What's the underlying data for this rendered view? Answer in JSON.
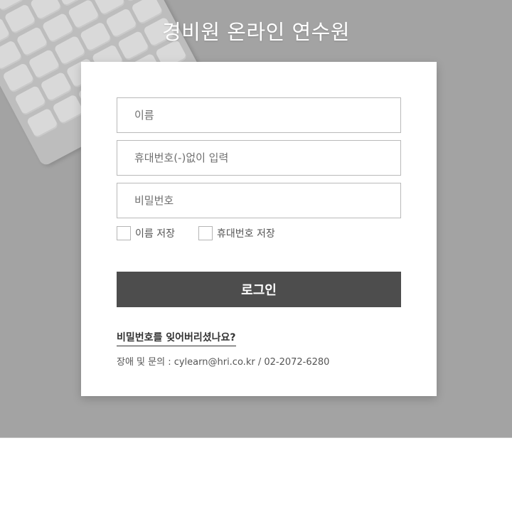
{
  "header": {
    "title": "경비원 온라인 연수원"
  },
  "form": {
    "name_placeholder": "이름",
    "phone_placeholder": "휴대번호(-)없이 입력",
    "password_placeholder": "비밀번호",
    "save_name_label": "이름 저장",
    "save_phone_label": "휴대번호 저장",
    "login_label": "로그인",
    "forgot_password_label": "비밀번호를 잊어버리셨나요?",
    "contact_text": "장애 및 문의 : cylearn@hri.co.kr / 02-2072-6280"
  },
  "colors": {
    "background_band": "#a3a3a3",
    "card": "#ffffff",
    "button": "#4d4d4d",
    "field_border": "#b9b9b9"
  }
}
